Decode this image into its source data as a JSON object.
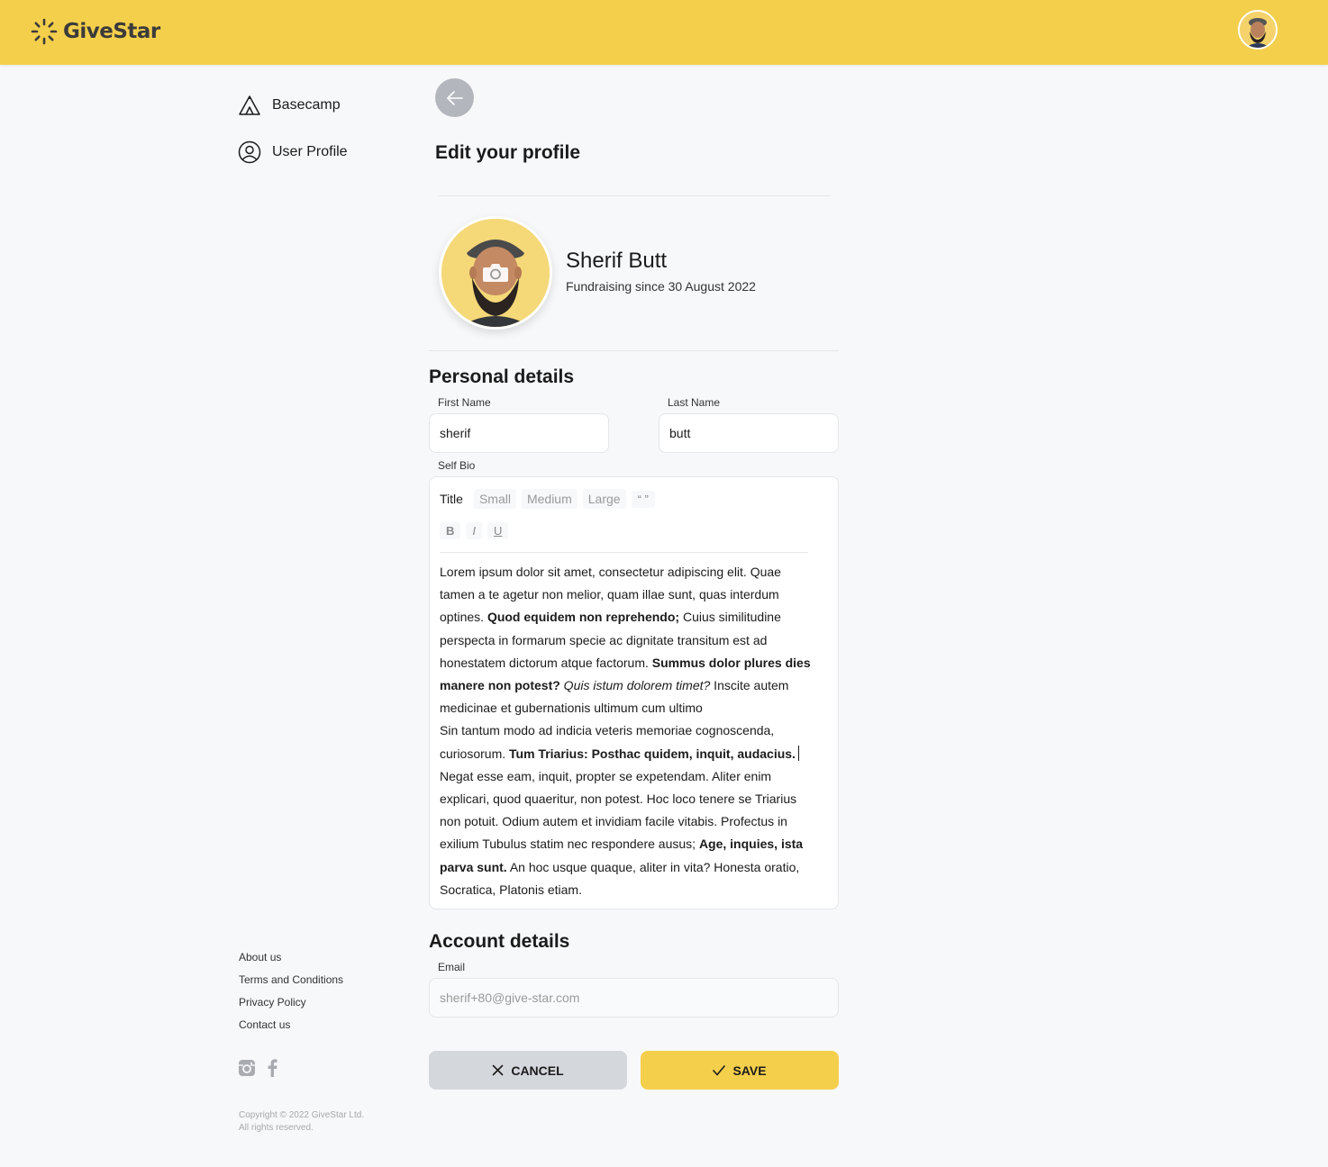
{
  "header": {
    "brand": "GiveStar",
    "logo_icon": "sunburst-logo-icon",
    "avatar_icon": "user-avatar"
  },
  "sidebar": {
    "items": [
      {
        "label": "Basecamp",
        "icon": "tent-icon"
      },
      {
        "label": "User Profile",
        "icon": "user-circle-icon"
      }
    ],
    "footer_links": [
      "About us",
      "Terms and Conditions",
      "Privacy Policy",
      "Contact us"
    ],
    "social": [
      "instagram-icon",
      "facebook-icon"
    ],
    "copyright": "Copyright © 2022 GiveStar Ltd. All rights reserved."
  },
  "main": {
    "title": "Edit your profile",
    "profile": {
      "name": "Sherif Butt",
      "since": "Fundraising since 30 August 2022"
    },
    "personal": {
      "heading": "Personal details",
      "first_name_label": "First Name",
      "first_name_value": "sherif",
      "last_name_label": "Last Name",
      "last_name_value": "butt",
      "bio_label": "Self Bio"
    },
    "editor": {
      "toolbar": [
        "Title",
        "Small",
        "Medium",
        "Large",
        "“ ”"
      ],
      "format": [
        "B",
        "I",
        "U"
      ],
      "p1": {
        "t1": "Lorem ipsum dolor sit amet, consectetur adipiscing elit. Quae tamen a te agetur non melior, quam illae sunt, quas interdum optines. ",
        "b1": "Quod equidem non reprehendo;",
        "t2": " Cuius similitudine perspecta in formarum specie ac dignitate transitum est ad honestatem dictorum atque factorum. ",
        "b2": "Summus dolor plures dies manere non potest?",
        "i1": " Quis istum dolorem timet?",
        "t3": " Inscite autem medicinae et gubernationis ultimum cum ultimo"
      },
      "p2": {
        "t1": "Sin tantum modo ad indicia veteris memoriae cognoscenda, curiosorum. ",
        "b1": "Tum Triarius: Posthac quidem, inquit, audacius."
      },
      "p3": {
        "t1": "Negat esse eam, inquit, propter se expetendam. Aliter enim explicari, quod quaeritur, non potest. Hoc loco tenere se Triarius non potuit. Odium autem et invidiam facile vitabis. Profectus in exilium Tubulus statim nec respondere ausus; ",
        "b1": "Age, inquies, ista parva sunt.",
        "t2": " An hoc usque quaque, aliter in vita? Honesta oratio, Socratica, Platonis etiam."
      }
    },
    "account": {
      "heading": "Account details",
      "email_label": "Email",
      "email_value": "sherif+80@give-star.com"
    },
    "actions": {
      "cancel": "CANCEL",
      "save": "SAVE"
    }
  },
  "colors": {
    "brand_yellow": "#f4cf4b",
    "cancel_gray": "#d4d7dc",
    "back_gray": "#b3b7bd",
    "background": "#f7f8fa"
  }
}
